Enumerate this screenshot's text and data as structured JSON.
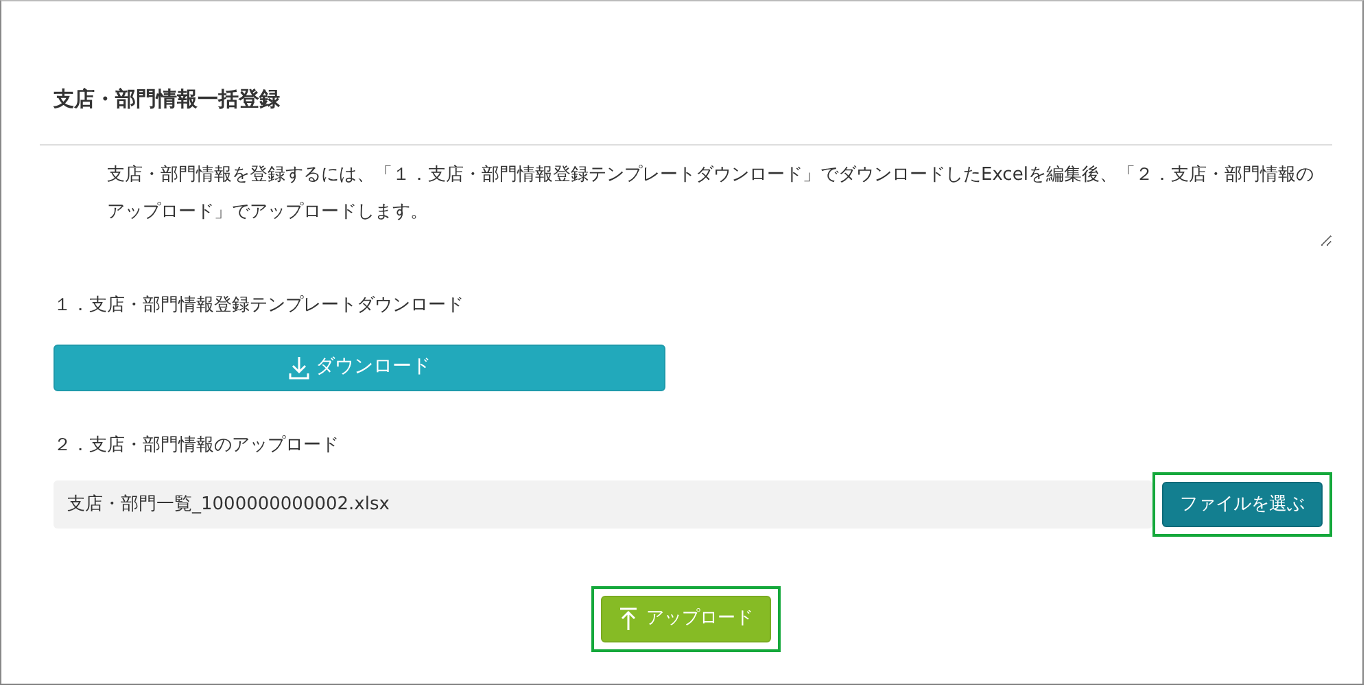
{
  "title": "支店・部門情報一括登録",
  "description": "支店・部門情報を登録するには、「１．支店・部門情報登録テンプレートダウンロード」でダウンロードしたExcelを編集後、「２．支店・部門情報のアップロード」でアップロードします。",
  "steps": [
    {
      "kind": "download",
      "label": "１．支店・部門情報登録テンプレートダウンロード",
      "button": {
        "label": "ダウンロード"
      }
    },
    {
      "kind": "upload",
      "label": "２．支店・部門情報のアップロード",
      "file_name": "支店・部門一覧_1000000000002.xlsx",
      "choose_button": {
        "label": "ファイルを選ぶ",
        "highlighted": true
      }
    }
  ],
  "upload_button": {
    "label": "アップロード",
    "highlighted": true
  }
}
